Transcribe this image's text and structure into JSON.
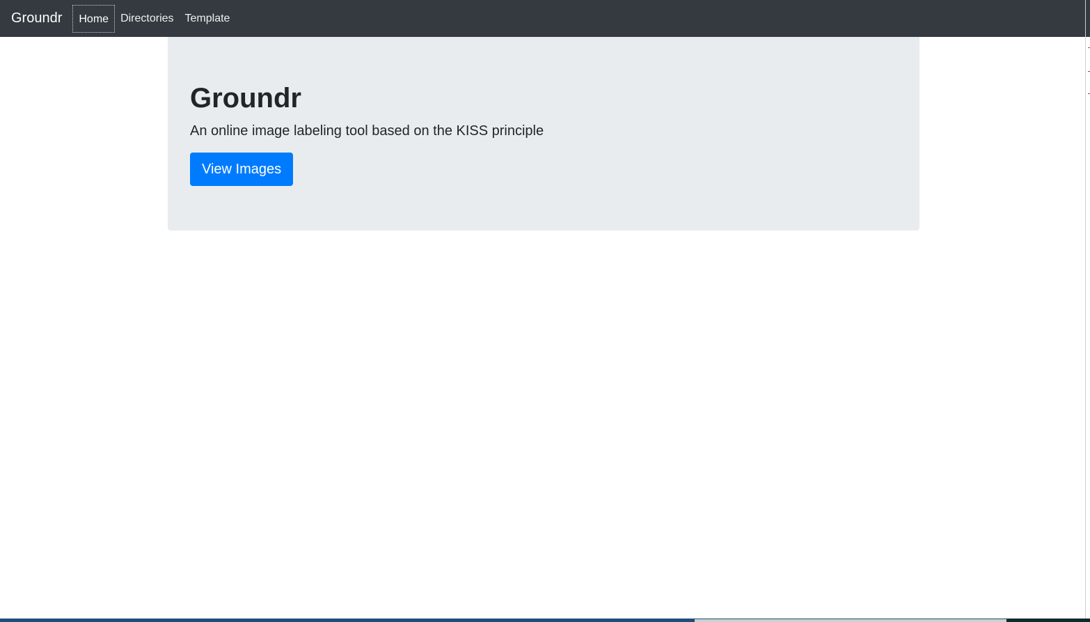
{
  "navbar": {
    "brand": "Groundr",
    "links": [
      {
        "label": "Home",
        "active": true
      },
      {
        "label": "Directories",
        "active": false
      },
      {
        "label": "Template",
        "active": false
      }
    ]
  },
  "jumbotron": {
    "title": "Groundr",
    "lead": "An online image labeling tool based on the KISS principle",
    "button_label": "View Images"
  },
  "colors": {
    "navbar_bg": "#343a40",
    "jumbotron_bg": "#e9ecef",
    "primary": "#007bff"
  }
}
